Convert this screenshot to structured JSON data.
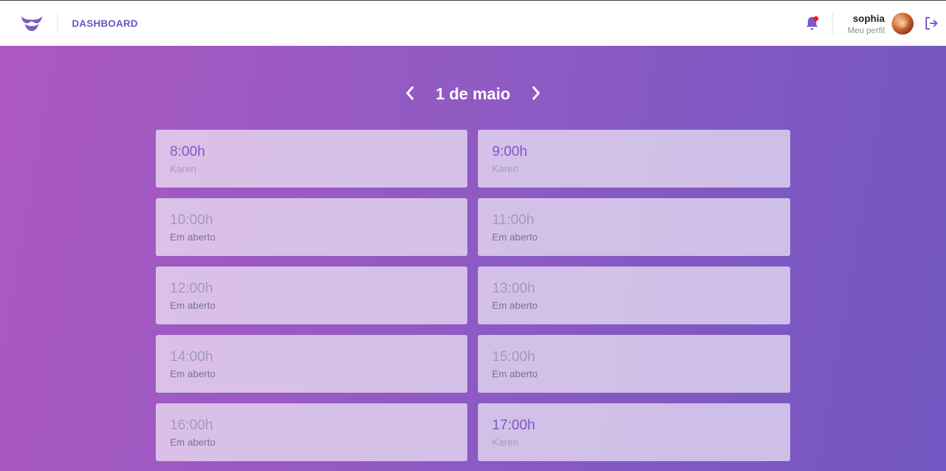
{
  "header": {
    "brand": "DASHBOARD",
    "user": {
      "name": "sophia",
      "profile_link": "Meu perfil"
    },
    "notifications": {
      "has_unread": true
    },
    "icons": [
      "mustache-logo-icon",
      "bell-icon",
      "avatar",
      "logout-icon"
    ]
  },
  "date_nav": {
    "title": "1 de maio",
    "prev_icon": "chevron-left-icon",
    "next_icon": "chevron-right-icon"
  },
  "slots": [
    {
      "time": "8:00h",
      "label": "Karen",
      "booked": true
    },
    {
      "time": "9:00h",
      "label": "Karen",
      "booked": true
    },
    {
      "time": "10:00h",
      "label": "Em aberto",
      "booked": false
    },
    {
      "time": "11:00h",
      "label": "Em aberto",
      "booked": false
    },
    {
      "time": "12:00h",
      "label": "Em aberto",
      "booked": false
    },
    {
      "time": "13:00h",
      "label": "Em aberto",
      "booked": false
    },
    {
      "time": "14:00h",
      "label": "Em aberto",
      "booked": false
    },
    {
      "time": "15:00h",
      "label": "Em aberto",
      "booked": false
    },
    {
      "time": "16:00h",
      "label": "Em aberto",
      "booked": false
    },
    {
      "time": "17:00h",
      "label": "Karen",
      "booked": true
    }
  ],
  "colors": {
    "brand": "#6c54c0",
    "gradient_start": "#ad58c2",
    "gradient_end": "#7256c1",
    "notification_dot": "#ff1414"
  }
}
